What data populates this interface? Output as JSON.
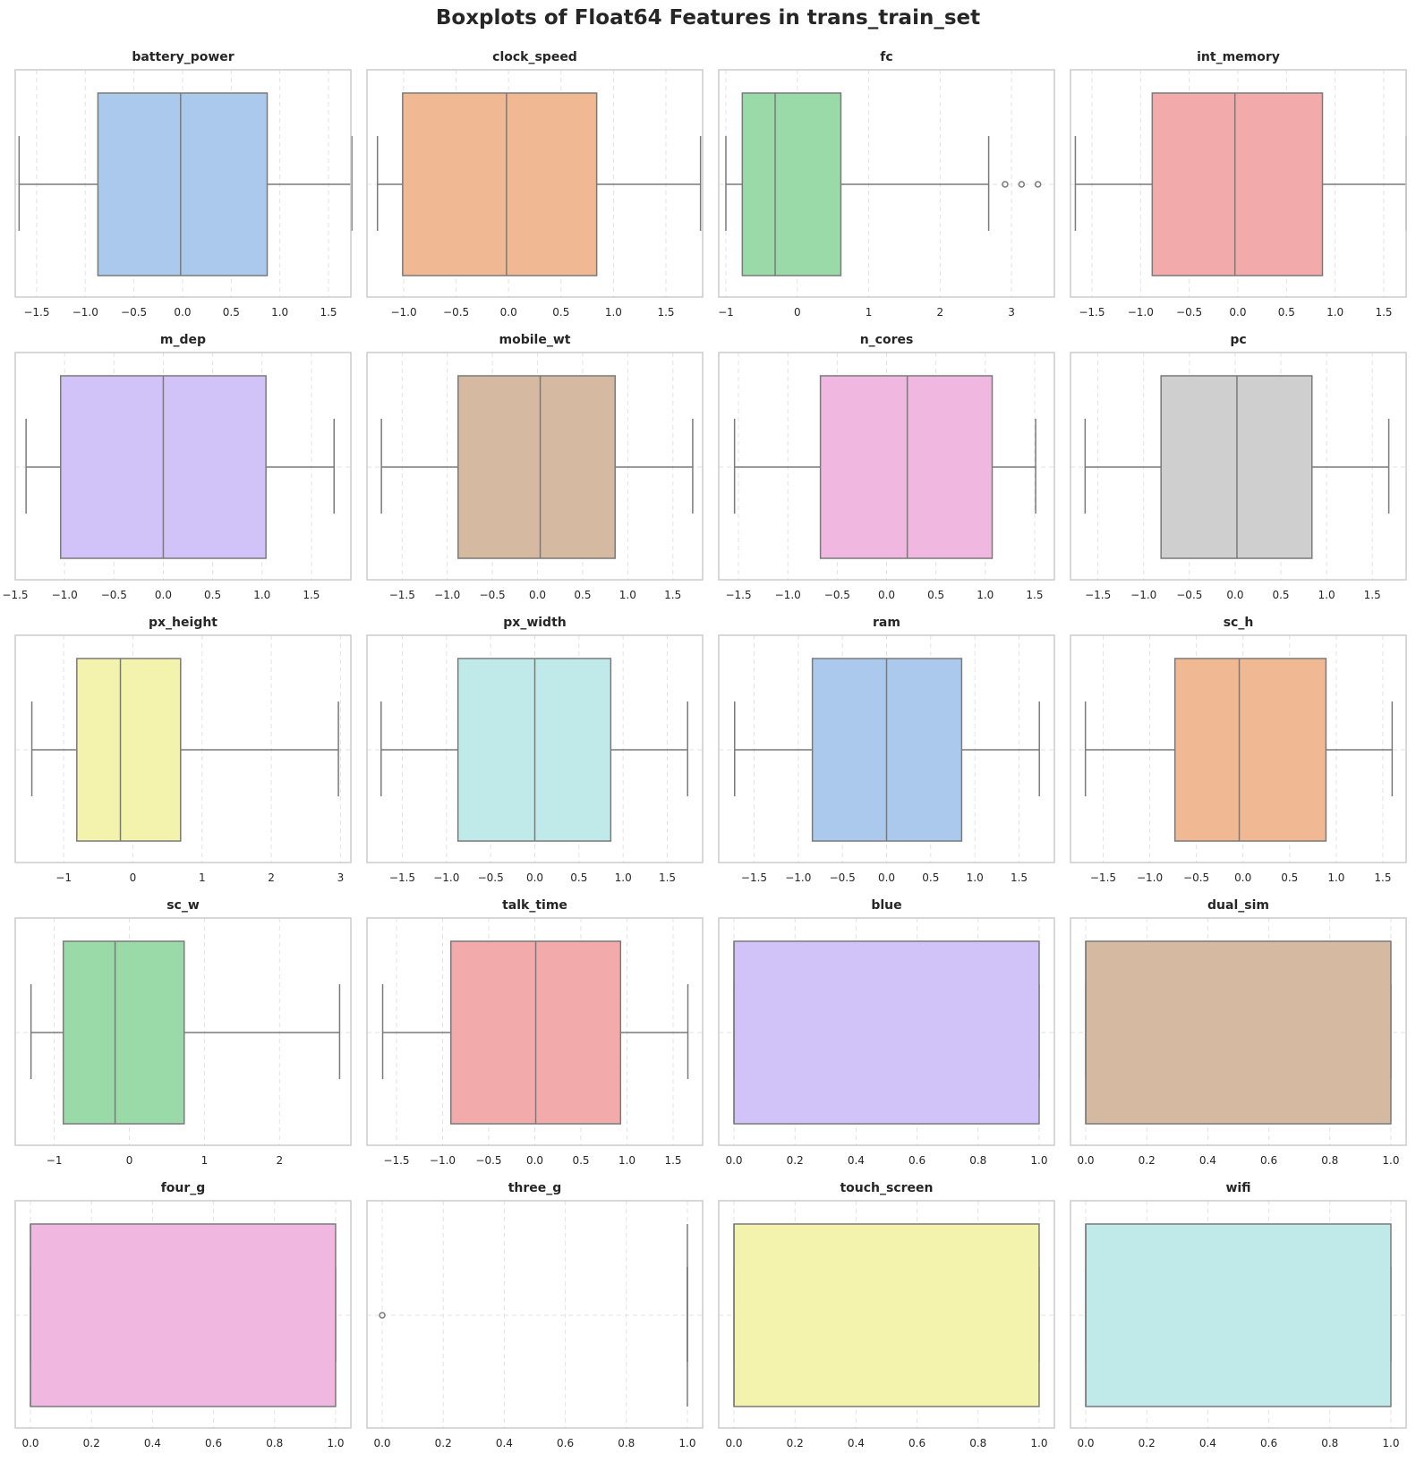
{
  "title": "Boxplots of Float64 Features in trans_train_set",
  "style": {
    "box_edge": "#7a7a7a",
    "grid": "#e3e3e3",
    "spine": "#cccccc",
    "text": "#262626"
  },
  "chart_data": [
    {
      "type": "box",
      "title": "battery_power",
      "xlim": [
        -1.72,
        1.73
      ],
      "ticks": [
        -1.5,
        -1.0,
        -0.5,
        0.0,
        0.5,
        1.0,
        1.5
      ],
      "tick_labels": [
        "−1.5",
        "−1.0",
        "−0.5",
        "0.0",
        "0.5",
        "1.0",
        "1.5"
      ],
      "whisker_low": -1.68,
      "q1": -0.87,
      "median": -0.02,
      "q3": 0.87,
      "whisker_high": 1.74,
      "outliers": [],
      "color": "#abc9ec"
    },
    {
      "type": "box",
      "title": "clock_speed",
      "xlim": [
        -1.35,
        1.85
      ],
      "ticks": [
        -1.0,
        -0.5,
        0.0,
        0.5,
        1.0,
        1.5
      ],
      "tick_labels": [
        "−1.0",
        "−0.5",
        "0.0",
        "0.5",
        "1.0",
        "1.5"
      ],
      "whisker_low": -1.25,
      "q1": -1.01,
      "median": -0.02,
      "q3": 0.84,
      "whisker_high": 1.83,
      "outliers": [],
      "color": "#f0b893"
    },
    {
      "type": "box",
      "title": "fc",
      "xlim": [
        -1.1,
        3.6
      ],
      "ticks": [
        -1,
        0,
        1,
        2,
        3
      ],
      "tick_labels": [
        "−1",
        "0",
        "1",
        "2",
        "3"
      ],
      "whisker_low": -1.0,
      "q1": -0.77,
      "median": -0.31,
      "q3": 0.61,
      "whisker_high": 2.68,
      "outliers": [
        2.91,
        3.14,
        3.37
      ],
      "color": "#99daa8"
    },
    {
      "type": "box",
      "title": "int_memory",
      "xlim": [
        -1.72,
        1.73
      ],
      "ticks": [
        -1.5,
        -1.0,
        -0.5,
        0.0,
        0.5,
        1.0,
        1.5
      ],
      "tick_labels": [
        "−1.5",
        "−1.0",
        "−0.5",
        "0.0",
        "0.5",
        "1.0",
        "1.5"
      ],
      "whisker_low": -1.67,
      "q1": -0.88,
      "median": -0.03,
      "q3": 0.87,
      "whisker_high": 1.73,
      "outliers": [],
      "color": "#f2abaa"
    },
    {
      "type": "box",
      "title": "m_dep",
      "xlim": [
        -1.5,
        1.9
      ],
      "ticks": [
        -1.5,
        -1.0,
        -0.5,
        0.0,
        0.5,
        1.0,
        1.5
      ],
      "tick_labels": [
        "−1.5",
        "−1.0",
        "−0.5",
        "0.0",
        "0.5",
        "1.0",
        "1.5"
      ],
      "whisker_low": -1.39,
      "q1": -1.04,
      "median": -0.0,
      "q3": 1.04,
      "whisker_high": 1.73,
      "outliers": [],
      "color": "#d1c3f7"
    },
    {
      "type": "box",
      "title": "mobile_wt",
      "xlim": [
        -1.89,
        1.83
      ],
      "ticks": [
        -1.5,
        -1.0,
        -0.5,
        0.0,
        0.5,
        1.0,
        1.5
      ],
      "tick_labels": [
        "−1.5",
        "−1.0",
        "−0.5",
        "0.0",
        "0.5",
        "1.0",
        "1.5"
      ],
      "whisker_low": -1.73,
      "q1": -0.88,
      "median": 0.03,
      "q3": 0.86,
      "whisker_high": 1.72,
      "outliers": [],
      "color": "#d5b9a1"
    },
    {
      "type": "box",
      "title": "n_cores",
      "xlim": [
        -1.7,
        1.7
      ],
      "ticks": [
        -1.5,
        -1.0,
        -0.5,
        0.0,
        0.5,
        1.0,
        1.5
      ],
      "tick_labels": [
        "−1.5",
        "−1.0",
        "−0.5",
        "0.0",
        "0.5",
        "1.0",
        "1.5"
      ],
      "whisker_low": -1.54,
      "q1": -0.67,
      "median": 0.21,
      "q3": 1.07,
      "whisker_high": 1.51,
      "outliers": [],
      "color": "#f0b7e0"
    },
    {
      "type": "box",
      "title": "pc",
      "xlim": [
        -1.8,
        1.87
      ],
      "ticks": [
        -1.5,
        -1.0,
        -0.5,
        0.0,
        0.5,
        1.0,
        1.5
      ],
      "tick_labels": [
        "−1.5",
        "−1.0",
        "−0.5",
        "0.0",
        "0.5",
        "1.0",
        "1.5"
      ],
      "whisker_low": -1.64,
      "q1": -0.81,
      "median": 0.02,
      "q3": 0.84,
      "whisker_high": 1.68,
      "outliers": [],
      "color": "#cfcfcf"
    },
    {
      "type": "box",
      "title": "px_height",
      "xlim": [
        -1.7,
        3.15
      ],
      "ticks": [
        -1,
        0,
        1,
        2,
        3
      ],
      "tick_labels": [
        "−1",
        "0",
        "1",
        "2",
        "3"
      ],
      "whisker_low": -1.46,
      "q1": -0.81,
      "median": -0.18,
      "q3": 0.69,
      "whisker_high": 2.97,
      "outliers": [],
      "color": "#f3f3ad"
    },
    {
      "type": "box",
      "title": "px_width",
      "xlim": [
        -1.9,
        1.9
      ],
      "ticks": [
        -1.5,
        -1.0,
        -0.5,
        0.0,
        0.5,
        1.0,
        1.5
      ],
      "tick_labels": [
        "−1.5",
        "−1.0",
        "−0.5",
        "0.0",
        "0.5",
        "1.0",
        "1.5"
      ],
      "whisker_low": -1.74,
      "q1": -0.87,
      "median": 0.0,
      "q3": 0.86,
      "whisker_high": 1.73,
      "outliers": [],
      "color": "#c0eae9"
    },
    {
      "type": "box",
      "title": "ram",
      "xlim": [
        -1.9,
        1.9
      ],
      "ticks": [
        -1.5,
        -1.0,
        -0.5,
        0.0,
        0.5,
        1.0,
        1.5
      ],
      "tick_labels": [
        "−1.5",
        "−1.0",
        "−0.5",
        "0.0",
        "0.5",
        "1.0",
        "1.5"
      ],
      "whisker_low": -1.72,
      "q1": -0.84,
      "median": 0.0,
      "q3": 0.85,
      "whisker_high": 1.73,
      "outliers": [],
      "color": "#abc9ec"
    },
    {
      "type": "box",
      "title": "sc_h",
      "xlim": [
        -1.85,
        1.75
      ],
      "ticks": [
        -1.5,
        -1.0,
        -0.5,
        0.0,
        0.5,
        1.0,
        1.5
      ],
      "tick_labels": [
        "−1.5",
        "−1.0",
        "−0.5",
        "0.0",
        "0.5",
        "1.0",
        "1.5"
      ],
      "whisker_low": -1.69,
      "q1": -0.73,
      "median": -0.04,
      "q3": 0.89,
      "whisker_high": 1.6,
      "outliers": [],
      "color": "#f0b893"
    },
    {
      "type": "box",
      "title": "sc_w",
      "xlim": [
        -1.52,
        2.95
      ],
      "ticks": [
        -1,
        0,
        1,
        2
      ],
      "tick_labels": [
        "−1",
        "0",
        "1",
        "2"
      ],
      "whisker_low": -1.31,
      "q1": -0.88,
      "median": -0.19,
      "q3": 0.73,
      "whisker_high": 2.8,
      "outliers": [],
      "color": "#99daa8"
    },
    {
      "type": "box",
      "title": "talk_time",
      "xlim": [
        -1.82,
        1.82
      ],
      "ticks": [
        -1.5,
        -1.0,
        -0.5,
        0.0,
        0.5,
        1.0,
        1.5
      ],
      "tick_labels": [
        "−1.5",
        "−1.0",
        "−0.5",
        "0.0",
        "0.5",
        "1.0",
        "1.5"
      ],
      "whisker_low": -1.65,
      "q1": -0.91,
      "median": 0.01,
      "q3": 0.93,
      "whisker_high": 1.66,
      "outliers": [],
      "color": "#f2abaa"
    },
    {
      "type": "box",
      "title": "blue",
      "xlim": [
        -0.05,
        1.05
      ],
      "ticks": [
        0.0,
        0.2,
        0.4,
        0.6,
        0.8,
        1.0
      ],
      "tick_labels": [
        "0.0",
        "0.2",
        "0.4",
        "0.6",
        "0.8",
        "1.0"
      ],
      "whisker_low": 0.0,
      "q1": 0.0,
      "median": 0.0,
      "q3": 1.0,
      "whisker_high": 1.0,
      "outliers": [],
      "color": "#d1c3f7"
    },
    {
      "type": "box",
      "title": "dual_sim",
      "xlim": [
        -0.05,
        1.05
      ],
      "ticks": [
        0.0,
        0.2,
        0.4,
        0.6,
        0.8,
        1.0
      ],
      "tick_labels": [
        "0.0",
        "0.2",
        "0.4",
        "0.6",
        "0.8",
        "1.0"
      ],
      "whisker_low": 0.0,
      "q1": 0.0,
      "median": 0.0,
      "q3": 1.0,
      "whisker_high": 1.0,
      "outliers": [],
      "color": "#d5b9a1"
    },
    {
      "type": "box",
      "title": "four_g",
      "xlim": [
        -0.05,
        1.05
      ],
      "ticks": [
        0.0,
        0.2,
        0.4,
        0.6,
        0.8,
        1.0
      ],
      "tick_labels": [
        "0.0",
        "0.2",
        "0.4",
        "0.6",
        "0.8",
        "1.0"
      ],
      "whisker_low": 0.0,
      "q1": 0.0,
      "median": 0.0,
      "q3": 1.0,
      "whisker_high": 1.0,
      "outliers": [],
      "color": "#f0b7e0"
    },
    {
      "type": "box",
      "title": "three_g",
      "xlim": [
        -0.05,
        1.05
      ],
      "ticks": [
        0.0,
        0.2,
        0.4,
        0.6,
        0.8,
        1.0
      ],
      "tick_labels": [
        "0.0",
        "0.2",
        "0.4",
        "0.6",
        "0.8",
        "1.0"
      ],
      "whisker_low": 1.0,
      "q1": 1.0,
      "median": 1.0,
      "q3": 1.0,
      "whisker_high": 1.0,
      "outliers": [
        0.0
      ],
      "color": "#cfcfcf"
    },
    {
      "type": "box",
      "title": "touch_screen",
      "xlim": [
        -0.05,
        1.05
      ],
      "ticks": [
        0.0,
        0.2,
        0.4,
        0.6,
        0.8,
        1.0
      ],
      "tick_labels": [
        "0.0",
        "0.2",
        "0.4",
        "0.6",
        "0.8",
        "1.0"
      ],
      "whisker_low": 0.0,
      "q1": 0.0,
      "median": 0.0,
      "q3": 1.0,
      "whisker_high": 1.0,
      "outliers": [],
      "color": "#f3f3ad"
    },
    {
      "type": "box",
      "title": "wifi",
      "xlim": [
        -0.05,
        1.05
      ],
      "ticks": [
        0.0,
        0.2,
        0.4,
        0.6,
        0.8,
        1.0
      ],
      "tick_labels": [
        "0.0",
        "0.2",
        "0.4",
        "0.6",
        "0.8",
        "1.0"
      ],
      "whisker_low": 0.0,
      "q1": 0.0,
      "median": 0.0,
      "q3": 1.0,
      "whisker_high": 1.0,
      "outliers": [],
      "color": "#c0eae9"
    }
  ]
}
